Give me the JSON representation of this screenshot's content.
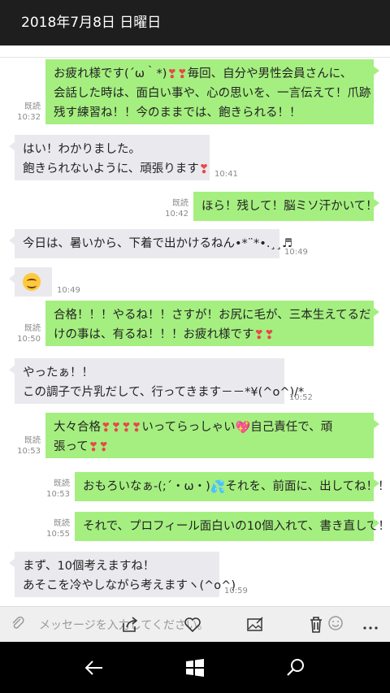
{
  "header": {
    "title": "2018年7月8日 日曜日"
  },
  "messages": [
    {
      "dir": "sent",
      "read": "既読",
      "time": "10:32",
      "lines": [
        [
          {
            "t": "お疲れ様です(´ω｀*)"
          },
          {
            "e": "heart"
          },
          {
            "e": "heart"
          },
          {
            "t": "毎回、自分や男性会員さんに、"
          }
        ],
        [
          {
            "t": "会話した時は、面白い事や、心の思いを、一言伝えて！爪跡"
          }
        ],
        [
          {
            "t": "残す練習ね！！今のままでは、飽きられる！！"
          }
        ]
      ]
    },
    {
      "dir": "recv",
      "time": "10:41",
      "lines": [
        [
          {
            "t": "はい！わかりました。"
          }
        ],
        [
          {
            "t": "飽きられないように、頑張ります"
          },
          {
            "e": "heart"
          }
        ]
      ]
    },
    {
      "dir": "sent",
      "read": "既読",
      "time": "10:42",
      "lines": [
        [
          {
            "t": "ほら！残して！脳ミソ汗かいて！"
          }
        ]
      ]
    },
    {
      "dir": "recv",
      "time": "10:49",
      "lines": [
        [
          {
            "t": "今日は、暑いから、下着で出かけるねん•*¨*•.¸¸♬"
          }
        ]
      ]
    },
    {
      "dir": "recv",
      "time": "10:49",
      "emoji_only": true,
      "lines": [
        [
          {
            "e": "smile"
          }
        ]
      ]
    },
    {
      "dir": "sent",
      "read": "既読",
      "time": "10:50",
      "lines": [
        [
          {
            "t": "合格！！！やるね！！さすが！お尻に毛が、三本生えてるだ"
          }
        ],
        [
          {
            "t": "けの事は、有るね！！！お疲れ様です"
          },
          {
            "e": "heart"
          },
          {
            "e": "heart"
          }
        ]
      ]
    },
    {
      "dir": "recv",
      "time": "10:52",
      "lines": [
        [
          {
            "t": "やったぁ！！"
          }
        ],
        [
          {
            "t": "この調子で片乳だして、行ってきます－－*¥(^o^)/*"
          }
        ]
      ]
    },
    {
      "dir": "sent",
      "read": "既読",
      "time": "10:53",
      "lines": [
        [
          {
            "t": "大々合格"
          },
          {
            "e": "heart"
          },
          {
            "e": "heart"
          },
          {
            "e": "heart"
          },
          {
            "e": "heart"
          },
          {
            "t": "いってらっしゃい"
          },
          {
            "e": "gift"
          },
          {
            "t": "自己責任で、頑"
          }
        ],
        [
          {
            "t": "張って"
          },
          {
            "e": "heart"
          },
          {
            "e": "heart"
          }
        ]
      ]
    },
    {
      "dir": "sent",
      "read": "既読",
      "time": "10:53",
      "lines": [
        [
          {
            "t": "おもろいなぁ-(;´・ω・)"
          },
          {
            "e": "drop"
          },
          {
            "t": "それを、前面に、出してね！！"
          }
        ]
      ]
    },
    {
      "dir": "sent",
      "read": "既読",
      "time": "10:55",
      "lines": [
        [
          {
            "t": "それで、プロフィール面白いの10個入れて、書き直して！"
          }
        ]
      ]
    },
    {
      "dir": "recv",
      "time": "10:59",
      "lines": [
        [
          {
            "t": "まず、10個考えますね！"
          }
        ],
        [
          {
            "t": "あそこを冷やしながら考えますヽ(^o^)"
          }
        ]
      ]
    }
  ],
  "composer": {
    "placeholder": "メッセージを入力してください。"
  },
  "toolbar_icons": [
    "attach-icon",
    "share-icon",
    "heart-icon",
    "image-edit-icon",
    "trash-icon",
    "emoji-icon",
    "mic-icon",
    "more-icon"
  ],
  "navbar_icons": [
    "back-icon",
    "windows-icon",
    "search-icon"
  ],
  "colors": {
    "sent_bubble": "#a5ef80",
    "recv_bubble": "#e9e9ee",
    "titlebar": "#1e1e1e",
    "navbar": "#000000"
  }
}
